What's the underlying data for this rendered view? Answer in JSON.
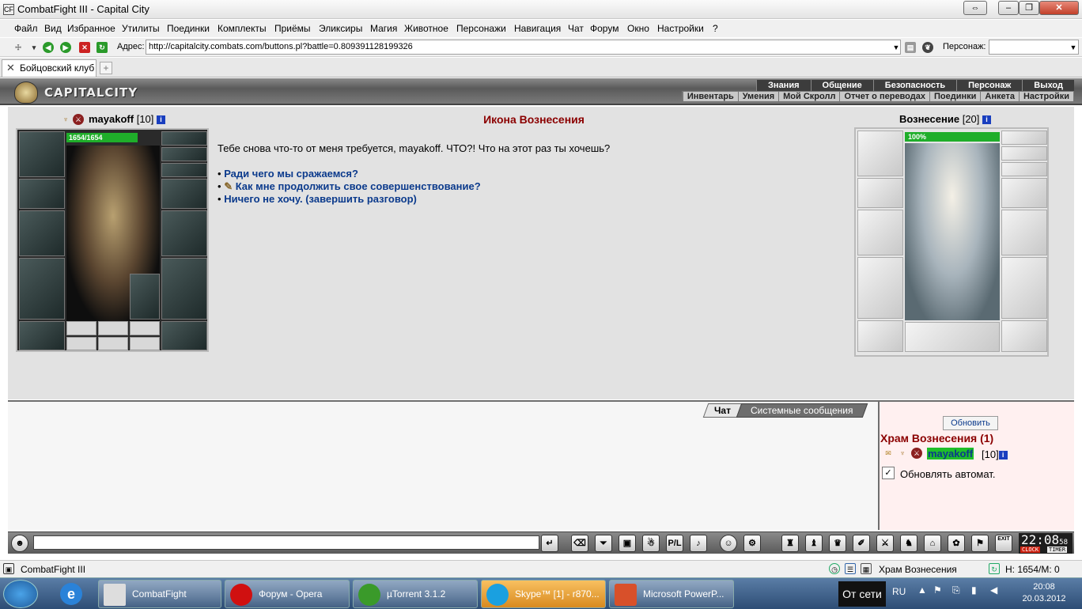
{
  "window": {
    "title": "CombatFight III - Capital City",
    "icon": "cf-app-icon",
    "buttons": [
      "restore",
      "minimize",
      "maximize",
      "close"
    ]
  },
  "menu": [
    "Файл",
    "Вид",
    "Избранное",
    "Утилиты",
    "Поединки",
    "Комплекты",
    "Приёмы",
    "Эликсиры",
    "Магия",
    "Животное",
    "Персонажи",
    "Навигация",
    "Чат",
    "Форум",
    "Окно",
    "Настройки",
    "?"
  ],
  "address": {
    "label": "Адрес:",
    "url": "http://capitalcity.combats.com/buttons.pl?battle=0.809391128199326",
    "char_label": "Персонаж:",
    "char_value": ""
  },
  "tab": {
    "label": "Бойцовский клуб",
    "new_tab": "+"
  },
  "game_header": {
    "logo": "CAPITALCITY",
    "nav1": [
      "Знания",
      "Общение",
      "Безопасность",
      "Персонаж",
      "Выход"
    ],
    "nav2": [
      "Инвентарь",
      "Умения",
      "Мой Скролл",
      "Отчет о переводах",
      "Поединки",
      "Анкета",
      "Настройки"
    ]
  },
  "player": {
    "name": "mayakoff",
    "level": "[10]",
    "hp": "1654/1654",
    "hp_fraction": 1.0,
    "info": "i"
  },
  "dialog": {
    "title": "Икона Вознесения",
    "text": "Тебе снова что-то от меня требуется, mayakoff. ЧТО?! Что на этот раз ты хочешь?",
    "options": [
      "Ради чего мы сражаемся?",
      "Как мне продолжить свое совершенствование?",
      "Ничего не хочу. (завершить разговор)"
    ],
    "bullet": "•"
  },
  "opponent": {
    "name": "Вознесение",
    "level": "[20]",
    "hp": "100%",
    "hp_fraction": 1.0,
    "info": "i"
  },
  "chat": {
    "tab_chat": "Чат",
    "tab_system": "Системные сообщения",
    "input_value": ""
  },
  "online": {
    "refresh": "Обновить",
    "room": "Храм Вознесения (1)",
    "user": "mayakoff",
    "level": "[10]",
    "auto_label": "Обновлять автомат.",
    "auto_checked": "✓"
  },
  "clock": {
    "time": "22:08",
    "sec": "58",
    "clock_label": "CLOCK",
    "timer_label": "TIMER",
    "exit_label": "EXIT"
  },
  "status": {
    "app": "CombatFight III",
    "location": "Храм Вознесения",
    "hm": "H: 1654/M: 0"
  },
  "taskbar": {
    "tasks": [
      "CombatFight",
      "Форум - Opera",
      "µTorrent 3.1.2",
      "Skype™ [1] - r870...",
      "Microsoft PowerP..."
    ],
    "offline": "От сети",
    "lang": "RU",
    "time": "20:08",
    "date": "20.03.2012"
  }
}
